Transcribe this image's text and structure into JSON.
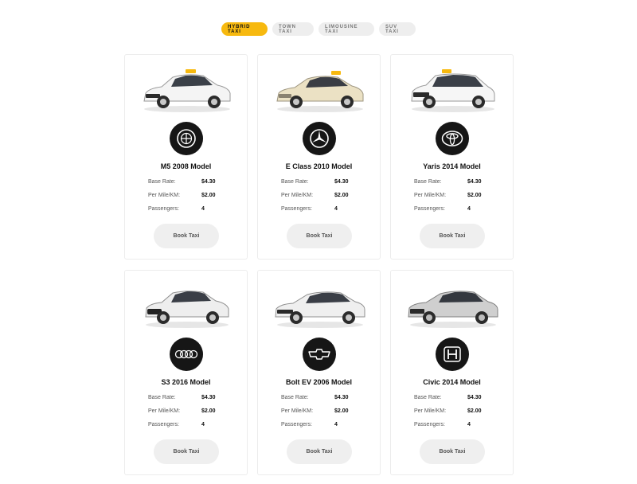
{
  "tabs": [
    {
      "label": "Hybrid Taxi",
      "active": true
    },
    {
      "label": "Town Taxi",
      "active": false
    },
    {
      "label": "Limousine Taxi",
      "active": false
    },
    {
      "label": "SUV Taxi",
      "active": false
    }
  ],
  "spec_labels": {
    "base": "Base Rate:",
    "mile": "Per Mile/KM:",
    "passengers": "Passengers:"
  },
  "cars": [
    {
      "model": "M5 2008 Model",
      "brand_icon": "bmw-logo-icon",
      "car_color": "white",
      "taxi_sign": true,
      "base_rate": "$4.30",
      "per_mile": "$2.00",
      "passengers": "4",
      "button": "Book Taxi"
    },
    {
      "model": "E Class 2010 Model",
      "brand_icon": "mercedes-logo-icon",
      "car_color": "beige",
      "taxi_sign": true,
      "base_rate": "$4.30",
      "per_mile": "$2.00",
      "passengers": "4",
      "button": "Book Taxi"
    },
    {
      "model": "Yaris 2014 Model",
      "brand_icon": "toyota-logo-icon",
      "car_color": "white",
      "taxi_sign": true,
      "base_rate": "$4.30",
      "per_mile": "$2.00",
      "passengers": "4",
      "button": "Book Taxi"
    },
    {
      "model": "S3 2016 Model",
      "brand_icon": "audi-logo-icon",
      "car_color": "silver",
      "taxi_sign": false,
      "base_rate": "$4.30",
      "per_mile": "$2.00",
      "passengers": "4",
      "button": "Book Taxi"
    },
    {
      "model": "Bolt EV 2006 Model",
      "brand_icon": "chevrolet-logo-icon",
      "car_color": "silver",
      "taxi_sign": false,
      "base_rate": "$4.30",
      "per_mile": "$2.00",
      "passengers": "4",
      "button": "Book Taxi"
    },
    {
      "model": "Civic 2014 Model",
      "brand_icon": "honda-logo-icon",
      "car_color": "silver",
      "taxi_sign": false,
      "base_rate": "$4.30",
      "per_mile": "$2.00",
      "passengers": "4",
      "button": "Book Taxi"
    }
  ],
  "colors": {
    "accent": "#f7b90f",
    "tab_inactive": "#eeeeee",
    "button_bg": "#efefef",
    "logo_bg": "#161616"
  }
}
